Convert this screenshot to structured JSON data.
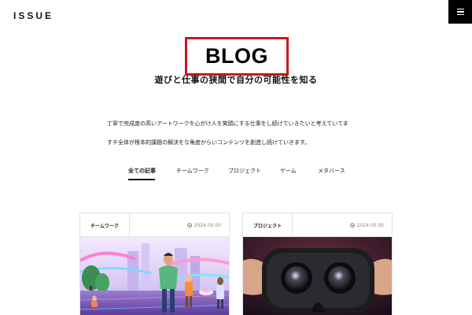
{
  "header": {
    "logo": "ISSUE",
    "menu_icon": "hamburger-menu-icon"
  },
  "hero": {
    "title": "BLOG",
    "highlight_color": "#c8161d",
    "subtitle": "遊びと仕事の狭間で自分の可能性を知る",
    "description_lines": [
      "丁寧で完成度の高いアートワークを心がけ人を笑顔にする仕事をし続けていきたいと考えていてま",
      "すチ全体が根本的課題の解決をな角度からいコンテンツを創造し続けていきます。"
    ]
  },
  "tabs": [
    {
      "label": "全ての記事",
      "active": true
    },
    {
      "label": "チームワーク",
      "active": false
    },
    {
      "label": "プロジェクト",
      "active": false
    },
    {
      "label": "ゲーム",
      "active": false
    },
    {
      "label": "メタバース",
      "active": false
    }
  ],
  "cards": [
    {
      "category": "チームワーク",
      "date": "2024.00.00",
      "date_icon": "clock-icon",
      "image": "metaverse-city-avatars-illustration"
    },
    {
      "category": "プロジェクト",
      "date": "2024.00.00",
      "date_icon": "clock-icon",
      "image": "vr-headset-photo"
    }
  ]
}
